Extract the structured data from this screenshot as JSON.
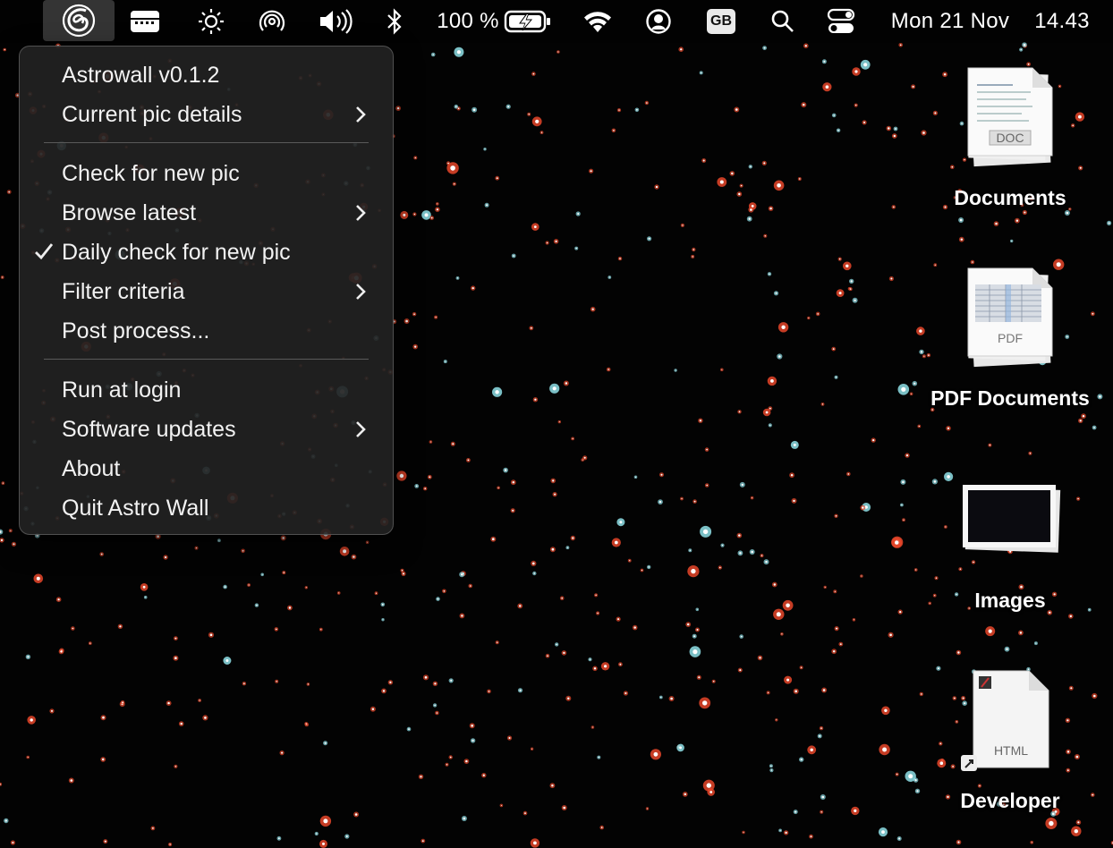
{
  "menubar": {
    "app_icon": "astrowall-spiral-icon",
    "status_icons": [
      "menu-display-icon",
      "brightness-icon",
      "airdrop-icon",
      "volume-icon",
      "bluetooth-icon"
    ],
    "battery_text": "100 %",
    "battery_icon": "battery-charging-icon",
    "wifi_icon": "wifi-icon",
    "user_icon": "user-account-icon",
    "input_source": "GB",
    "search_icon": "spotlight-search-icon",
    "control_center_icon": "control-center-icon",
    "date": "Mon 21 Nov",
    "time": "14.43"
  },
  "menu": {
    "items": [
      {
        "label": "Astrowall v0.1.2"
      },
      {
        "label": "Current pic details",
        "submenu": true
      },
      {
        "label": "Check for new pic"
      },
      {
        "label": "Browse latest",
        "submenu": true
      },
      {
        "label": "Daily check for new pic",
        "checked": true
      },
      {
        "label": "Filter criteria",
        "submenu": true
      },
      {
        "label": "Post process..."
      },
      {
        "label": "Run at login"
      },
      {
        "label": "Software updates",
        "submenu": true
      },
      {
        "label": "About"
      },
      {
        "label": "Quit Astro Wall"
      }
    ]
  },
  "desktop": {
    "documents": {
      "label": "Documents",
      "badge": "DOC"
    },
    "pdf_documents": {
      "label": "PDF Documents",
      "badge": "PDF"
    },
    "images": {
      "label": "Images"
    },
    "developer": {
      "label": "Developer",
      "badge": "HTML"
    }
  },
  "colors": {
    "background": "#030303",
    "menu_bg": "#222222",
    "star_red": "#e8472a",
    "star_cyan": "#8fe0e8"
  }
}
